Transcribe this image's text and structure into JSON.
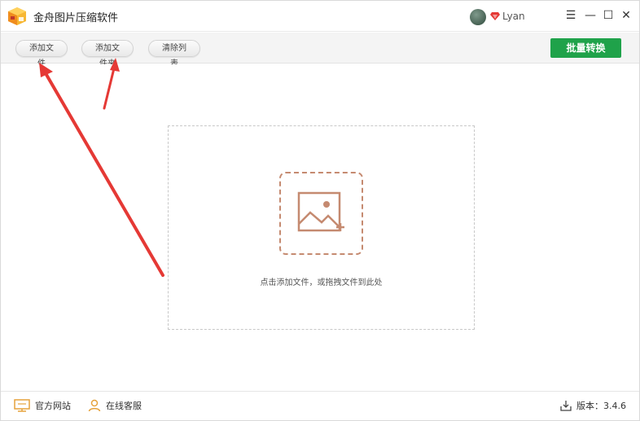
{
  "app": {
    "title": "金舟图片压缩软件",
    "user_name": "Lyan"
  },
  "window_controls": {
    "menu": "☰",
    "minimize": "—",
    "maximize": "☐",
    "close": "✕"
  },
  "toolbar": {
    "add_file_label": "添加文件",
    "add_folder_label": "添加文件夹",
    "clear_list_label": "清除列表",
    "batch_convert_label": "批量转换"
  },
  "main": {
    "drop_hint": "点击添加文件，或拖拽文件到此处"
  },
  "statusbar": {
    "website_label": "官方网站",
    "service_label": "在线客服",
    "version_label": "版本：3.4.6"
  },
  "colors": {
    "accent_green": "#1fa24a",
    "icon_brown": "#c58a70",
    "annotation_red": "#e53935",
    "logo_orange": "#f5a623"
  },
  "icons": {
    "logo": "box-logo-icon",
    "vip": "diamond-icon",
    "add_image": "image-add-icon",
    "website": "monitor-icon",
    "service": "user-icon",
    "version": "download-icon"
  }
}
